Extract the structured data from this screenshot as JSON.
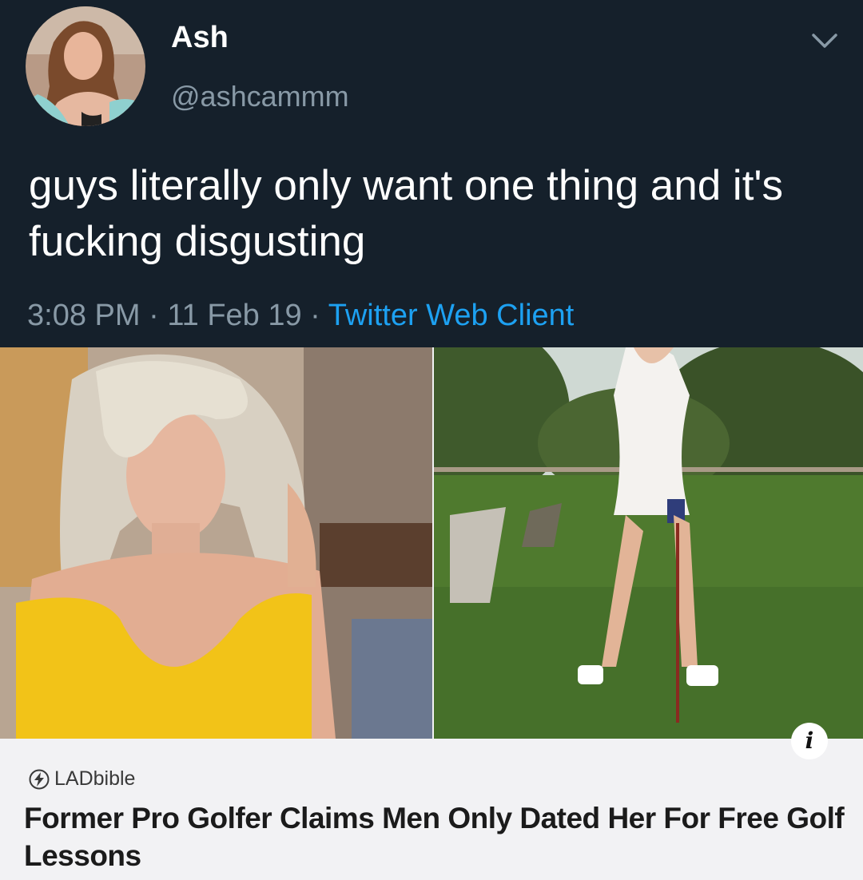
{
  "tweet": {
    "display_name": "Ash",
    "handle": "@ashcammm",
    "text": "guys literally only want one thing and it's fucking disgusting",
    "time": "3:08 PM",
    "sep": " · ",
    "date": "11 Feb 19",
    "source": "Twitter Web Client",
    "menu_icon": "chevron-down-icon"
  },
  "card": {
    "source_name": "LADbible",
    "source_icon": "lightning-bolt-icon",
    "info_icon": "info-icon",
    "info_glyph": "i",
    "headline": "Former Pro Golfer Claims Men Only Dated Her For Free Golf Lessons"
  },
  "colors": {
    "background": "#15202b",
    "link": "#1da1f2",
    "muted": "#8899a6",
    "card_bg": "#f2f2f4"
  }
}
